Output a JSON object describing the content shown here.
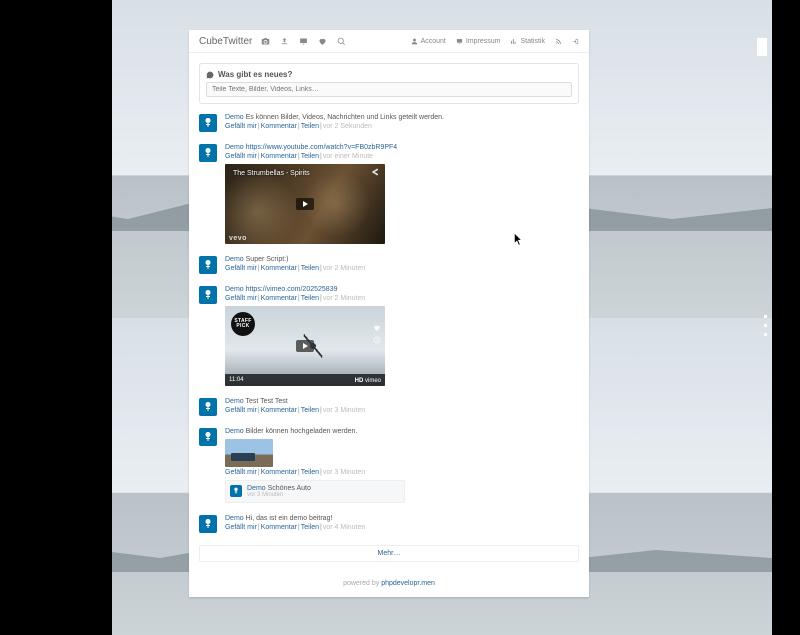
{
  "brand": "CubeTwitter",
  "nav": {
    "account": "Account",
    "impressum": "Impressum",
    "statistik": "Statistik"
  },
  "compose": {
    "title": "Was gibt es neues?",
    "placeholder": "Teile Texte, Bilder, Videos, Links…"
  },
  "meta": {
    "like": "Gefällt mir",
    "comment": "Kommentar",
    "share": "Teilen"
  },
  "more": "Mehr…",
  "footer": {
    "prefix": "powered by ",
    "link": "phpdevelopr.men"
  },
  "posts": [
    {
      "author": "Demo",
      "text": "Es können Bilder, Videos, Nachrichten und Links geteilt werden.",
      "time": "vor 2 Sekunden"
    },
    {
      "author": "Demo",
      "text": "https://www.youtube.com/watch?v=FB0zbR9PF4",
      "time": "vor einer Minute",
      "video": {
        "title": "The Strumbellas - Spirits",
        "brand": "vevo"
      }
    },
    {
      "author": "Demo",
      "text": "Super Script:)",
      "time": "vor 2 Minuten"
    },
    {
      "author": "Demo",
      "text": "https://vimeo.com/202525839",
      "time": "vor 2 Minuten",
      "video": {
        "staffpick": "STAFF PICK",
        "duration": "11:04",
        "hd": "HD",
        "vimeo": "vimeo"
      }
    },
    {
      "author": "Demo",
      "text": "Test Test Test",
      "time": "vor 3 Minuten"
    },
    {
      "author": "Demo",
      "text": "Bilder können hochgeladen werden.",
      "time": "vor 3 Minuten",
      "comment": {
        "author": "Demo",
        "text": "Schönes Auto",
        "time": "vor 3 Minuten"
      }
    },
    {
      "author": "Demo",
      "text": "Hi, das ist ein demo beitrag!",
      "time": "vor 4 Minuten"
    }
  ]
}
